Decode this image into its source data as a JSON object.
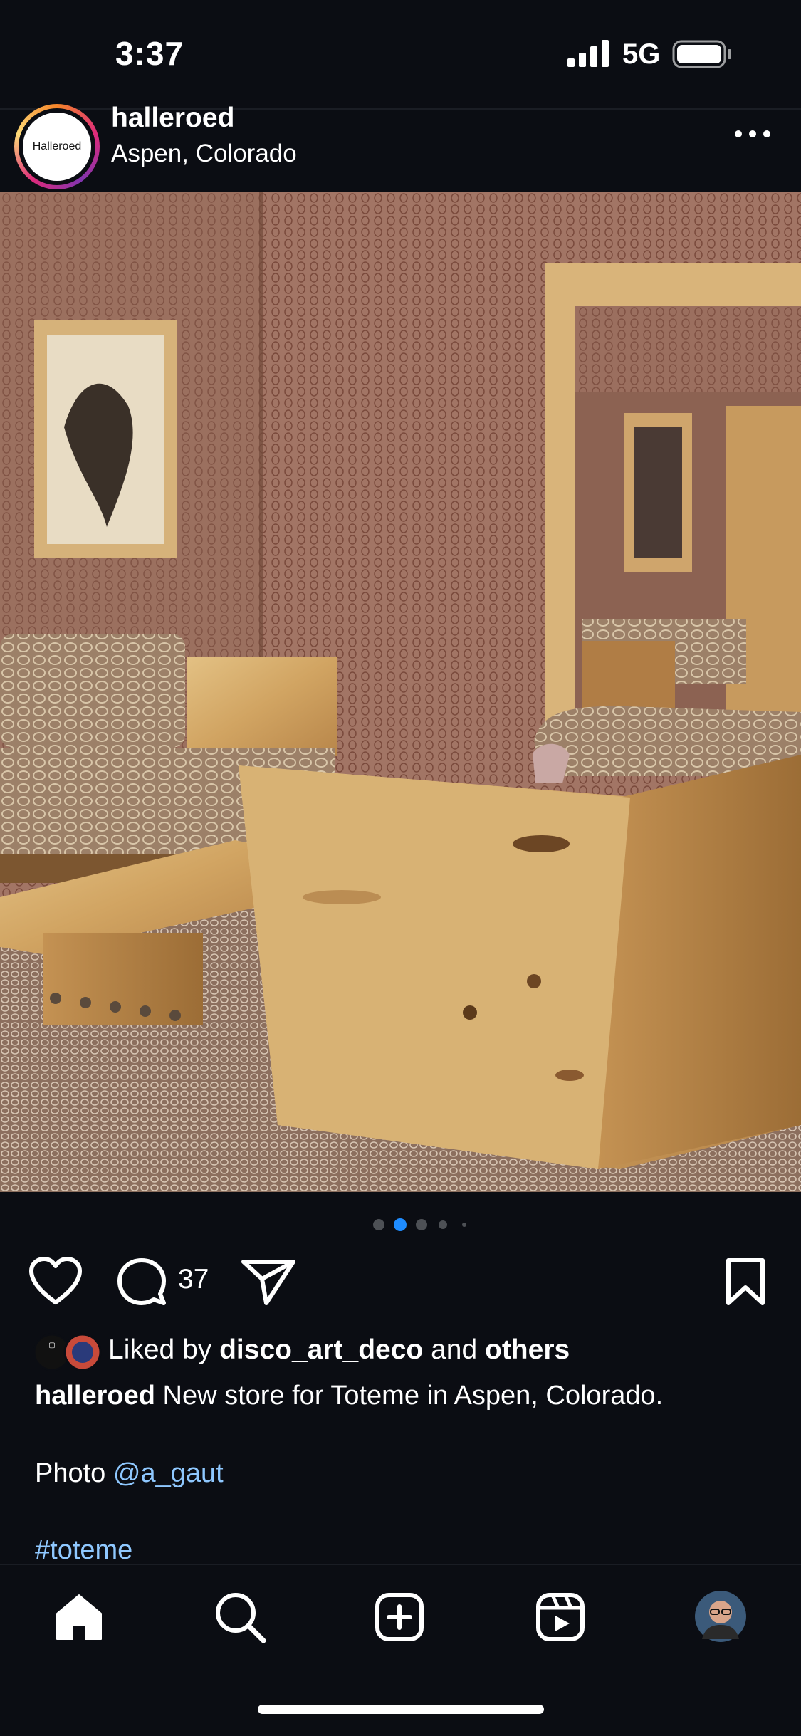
{
  "status_bar": {
    "time": "3:37",
    "network": "5G"
  },
  "post": {
    "username": "halleroed",
    "location": "Aspen, Colorado",
    "avatar_text": "Halleroed",
    "comment_count": "37",
    "carousel": {
      "count": 5,
      "active": 2
    },
    "liked_by": {
      "prefix": "Liked by",
      "user": "disco_art_deco",
      "middle": "and",
      "others": "others"
    },
    "caption": {
      "user": "halleroed",
      "text": "New store for Toteme in Aspen, Colorado."
    },
    "credit": {
      "prefix": "Photo",
      "mention": "@a_gaut"
    },
    "hashtag": "#toteme"
  },
  "tab_bar": {
    "items": [
      "home-icon",
      "search-icon",
      "new-post-icon",
      "reels-icon",
      "profile-avatar"
    ]
  },
  "colors": {
    "background": "#0b0d13",
    "link": "#8fc8ff",
    "active_dot": "#1e8cff"
  }
}
